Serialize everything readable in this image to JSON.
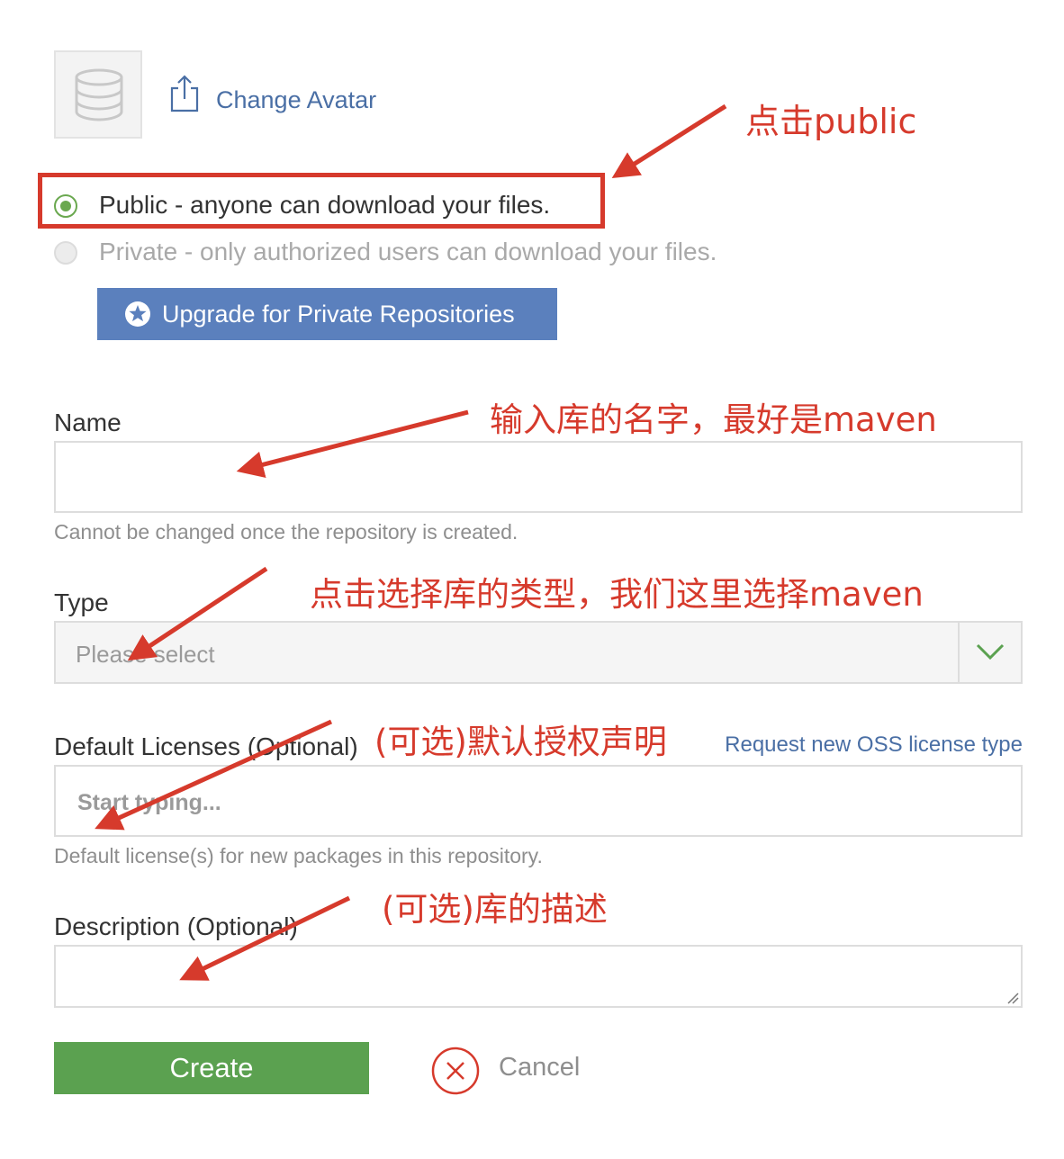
{
  "avatar": {
    "icon": "database-icon",
    "change_label": "Change Avatar"
  },
  "visibility": {
    "public_label": "Public - anyone can download your files.",
    "private_label": "Private - only authorized users can download your files.",
    "selected": "public",
    "upgrade_label": "Upgrade for Private Repositories"
  },
  "fields": {
    "name": {
      "label": "Name",
      "value": "",
      "help": "Cannot be changed once the repository is created."
    },
    "type": {
      "label": "Type",
      "placeholder": "Please select"
    },
    "licenses": {
      "label": "Default Licenses (Optional)",
      "placeholder": "Start typing...",
      "help": "Default license(s) for new packages in this repository.",
      "request_link": "Request new OSS license type"
    },
    "description": {
      "label": "Description (Optional)",
      "value": ""
    }
  },
  "actions": {
    "create_label": "Create",
    "cancel_label": "Cancel"
  },
  "annotations": {
    "click_public": "点击public",
    "enter_name": "输入库的名字，最好是maven",
    "select_type": "点击选择库的类型，我们这里选择maven",
    "licenses_optional": "(可选)默认授权声明",
    "description_optional": "(可选)库的描述"
  },
  "colors": {
    "accent_blue": "#5b80bd",
    "link_blue": "#4a6fa5",
    "create_green": "#5ba150",
    "radio_green": "#6aa84f",
    "annotation_red": "#d63a2c"
  }
}
